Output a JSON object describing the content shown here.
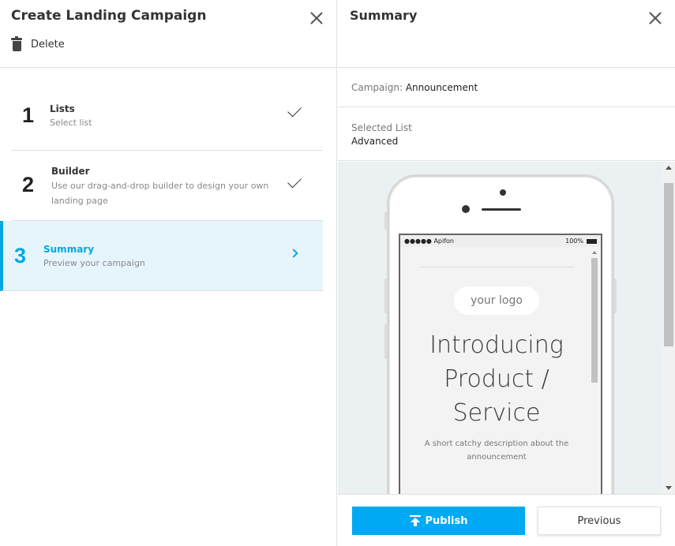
{
  "left_panel": {
    "title": "Create Landing Campaign",
    "delete_label": "Delete",
    "steps": [
      {
        "number": "1",
        "title": "Lists",
        "subtitle": "Select list",
        "status": "complete"
      },
      {
        "number": "2",
        "title": "Builder",
        "subtitle": "Use our drag-and-drop builder to design your own landing page",
        "status": "complete"
      },
      {
        "number": "3",
        "title": "Summary",
        "subtitle": "Preview your campaign",
        "status": "active"
      }
    ]
  },
  "right_panel": {
    "title": "Summary",
    "campaign_label": "Campaign:",
    "campaign_value": "Announcement",
    "list_label": "Selected List",
    "list_value": "Advanced",
    "preview": {
      "carrier": "●●●●● Apifon",
      "battery": "100%",
      "logo_text": "your logo",
      "headline": "Introducing Product / Service",
      "description": "A short catchy description about the announcement"
    },
    "publish_label": "Publish",
    "previous_label": "Previous"
  },
  "colors": {
    "accent": "#00a9e0",
    "publish_button": "#00a9f4",
    "active_step_bg": "#e6f5fc",
    "preview_bg": "#ebf0f3"
  }
}
